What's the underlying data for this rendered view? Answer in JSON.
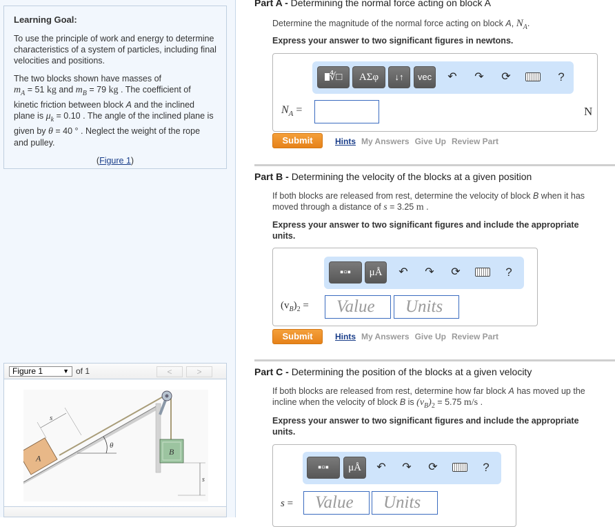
{
  "sidebar": {
    "goal_title": "Learning Goal:",
    "goal_text": "To use the principle of work and energy to determine characteristics of a system of particles, including final velocities and positions.",
    "problem": {
      "intro": "The two blocks shown have masses of",
      "mA_label": "m",
      "mA_sub": "A",
      "mA_eq": " = 51 ",
      "mA_unit": "kg",
      "and": " and ",
      "mB_label": "m",
      "mB_sub": "B",
      "mB_eq": " = 79 ",
      "mB_unit": "kg",
      "text2": " . The coefficient of kinetic friction between block ",
      "blockA": "A",
      "text3": " and the inclined plane is ",
      "mu": "μ",
      "mu_sub": "k",
      "mu_eq": " = 0.10 . The angle of the inclined plane is given by ",
      "theta": "θ",
      "theta_eq": " = 40 ° . Neglect the weight of the rope and pulley."
    },
    "figure_link_open": "(",
    "figure_link": "Figure 1",
    "figure_link_close": ")",
    "figure_panel": {
      "selected": "Figure 1",
      "of_text": "of 1",
      "prev": "<",
      "next": ">",
      "labels": {
        "blockA": "A",
        "blockB": "B",
        "s_incline": "s",
        "theta": "θ",
        "s_drop": "s"
      }
    }
  },
  "parts": [
    {
      "prefix": "Part A - ",
      "title": "Determining the normal force acting on block A",
      "question_pre": "Determine the magnitude of the normal force acting on block ",
      "question_var": "A",
      "question_mid": ", ",
      "question_sym": "N",
      "question_sym_sub": "A",
      "question_end": ".",
      "instruction": "Express your answer to two significant figures in newtons.",
      "toolbar": [
        "template-sqrt",
        "ΑΣφ",
        "↓↑",
        "vec"
      ],
      "answer_label": "N",
      "answer_label_sub": "A",
      "answer_eq": " =",
      "answer_value": "",
      "unit": "N"
    },
    {
      "prefix": "Part B - ",
      "title": "Determining the velocity of the blocks at a given position",
      "question_pre": "If both blocks are released from rest, determine the velocity of block ",
      "question_var": "B",
      "question_mid": " when it has moved through a distance of ",
      "question_sym": "s",
      "question_end": " = 3.25 ",
      "question_unit": "m",
      "question_tail": " .",
      "instruction": "Express your answer to two significant figures and include the appropriate units.",
      "toolbar": [
        "template-fraction",
        "μÅ"
      ],
      "answer_label": "(v",
      "answer_label_sub": "B",
      "answer_label_close": ")",
      "answer_label_sub2": "2",
      "answer_eq": " =",
      "value_placeholder": "Value",
      "units_placeholder": "Units"
    },
    {
      "prefix": "Part C - ",
      "title": "Determining the position of the blocks at a given velocity",
      "question_pre": "If both blocks are released from rest, determine how far block ",
      "question_var": "A",
      "question_mid": " has moved up the incline when the velocity of block ",
      "question_var2": "B",
      "question_is": " is ",
      "question_sym": "(v",
      "question_sym_sub": "B",
      "question_sym_close": ")",
      "question_sym_sub2": "2",
      "question_end": " = 5.75 ",
      "question_unit": "m/s",
      "question_tail": " .",
      "instruction": "Express your answer to two significant figures and include the appropriate units.",
      "toolbar": [
        "template-fraction",
        "μÅ"
      ],
      "answer_label": "s",
      "answer_eq": " =",
      "value_placeholder": "Value",
      "units_placeholder": "Units"
    }
  ],
  "toolbar_common": {
    "undo": "↶",
    "redo": "↷",
    "reset": "⟳",
    "help": "?"
  },
  "actions": {
    "submit": "Submit",
    "hints": "Hints",
    "my_answers": "My Answers",
    "give_up": "Give Up",
    "review_part": "Review Part"
  },
  "colors": {
    "submit": "#EC8A23",
    "toolbar_bg": "#CFE4FB",
    "link": "#1A3E8A",
    "sidebar_bg": "#F2F7FD",
    "input_border": "#3A6BBF"
  }
}
